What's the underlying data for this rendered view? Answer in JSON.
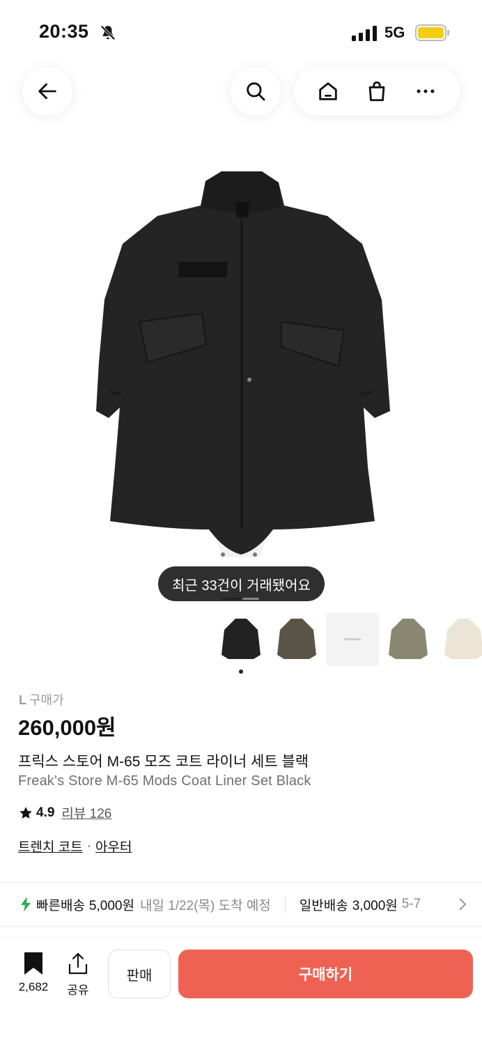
{
  "status": {
    "time": "20:35",
    "network": "5G",
    "icons": [
      "bell-off-icon",
      "signal-icon",
      "battery-icon"
    ],
    "battery_color": "#f5cc14"
  },
  "nav": {
    "icons": [
      "back-arrow-icon",
      "search-icon",
      "home-icon",
      "shopping-bag-icon",
      "more-icon"
    ]
  },
  "hero": {
    "trade_badge": "최근 33건이 거래됐어요",
    "carousel_position": 1
  },
  "thumbnails": [
    {
      "name": "black-coat"
    },
    {
      "name": "olive-coat"
    },
    {
      "name": "box-label"
    },
    {
      "name": "khaki-coat"
    },
    {
      "name": "cream-coat"
    }
  ],
  "product": {
    "size": "L",
    "size_price_label": "구매가",
    "price": "260,000원",
    "title_ko": "프릭스 스토어 M-65 모즈 코트 라이너 세트 블랙",
    "title_en": "Freak's Store M-65 Mods Coat Liner Set Black",
    "rating": "4.9",
    "reviews": "리뷰 126",
    "category_main": "트렌치 코트",
    "category_sep": "·",
    "category_sub": "아우터"
  },
  "shipping": {
    "fast_label": "빠른배송",
    "fast_price": "5,000원",
    "fast_date": "내일 1/22(목) 도착 예정",
    "normal_label": "일반배송",
    "normal_price": "3,000원",
    "normal_date": "5-7",
    "accent": "#22b14c"
  },
  "bottom": {
    "bookmark_count": "2,682",
    "share_label": "공유",
    "sell_label": "판매",
    "buy_label": "구매하기",
    "buy_color": "#ef6253"
  }
}
